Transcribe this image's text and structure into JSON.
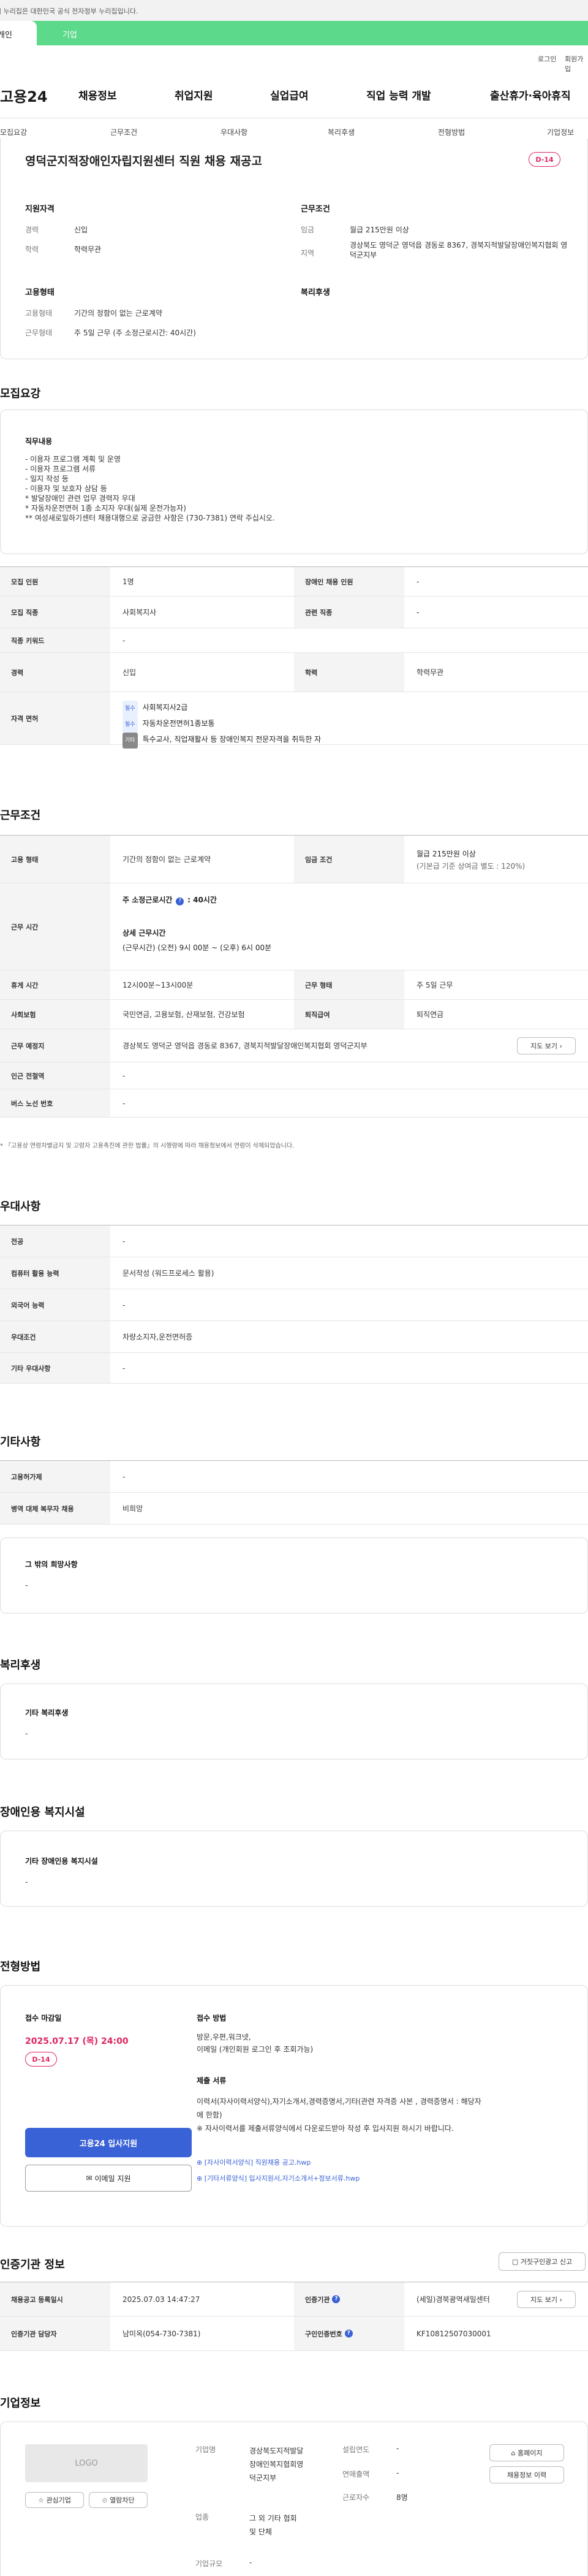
{
  "gov_notice": "이 누리집은 대한민국 공식 전자정부 누리집입니다.",
  "top_tabs": [
    "개인",
    "기업"
  ],
  "util_links": [
    "로그인",
    "회원가입"
  ],
  "logo_text": "고용24",
  "gnb": [
    "채용정보",
    "취업지원",
    "실업급여",
    "직업 능력 개발",
    "출산휴가·육아휴직"
  ],
  "subnav": [
    "모집요강",
    "근무조건",
    "우대사항",
    "복리후생",
    "전형방법",
    "기업정보"
  ],
  "summary": {
    "title": "영덕군지적장애인자립지원센터 직원 채용 재공고",
    "dday": "D-14",
    "qual_heading": "지원자격",
    "cond_heading": "근무조건",
    "emp_heading": "고용형태",
    "welfare_heading": "복리후생",
    "career_label": "경력",
    "career_value": "신입",
    "edu_label": "학력",
    "edu_value": "학력무관",
    "wage_label": "임금",
    "wage_value": "월급 215만원 이상",
    "area_label": "지역",
    "area_value": "경상북도 영덕군 영덕읍 경동로 8367, 경북지적발달장애인복지협회 영덕군지부",
    "etype_label": "고용형태",
    "etype_value": "기간의 정함이 없는 근로계약",
    "wtype_label": "근무형태",
    "wtype_value": "주 5일 근무 (주 소정근로시간: 40시간)"
  },
  "recruit": {
    "heading": "모집요강",
    "duty_title": "직무내용",
    "duty_text": "- 이용자 프로그램 계획 및 운영\n- 이용자 프로그램 서류\n- 일지 작성 등\n- 이용자 및 보호자 상담 등\n* 발달장애인 관련 업무 경력자 우대\n* 자동차운전면허 1종 소지자 우대(실제 운전가능자)\n** 여성새로일하기센터 채용대행으로 궁금한 사항은 (730-7381) 연락 주십시오.",
    "rows": {
      "headcount_label": "모집 인원",
      "headcount_value": "1명",
      "disabled_label": "장애인 채용 인원",
      "disabled_value": "-",
      "job_label": "모집 직종",
      "job_value": "사회복지사",
      "related_label": "관련 직종",
      "related_value": "-",
      "keyword_label": "직종 키워드",
      "keyword_value": "-",
      "career_label": "경력",
      "career_value": "신입",
      "edu_label": "학력",
      "edu_value": "학력무관",
      "license_label": "자격 면허",
      "license_items": [
        {
          "tag": "필수",
          "text": "사회복지사2급"
        },
        {
          "tag": "필수",
          "text": "자동차운전면허1종보통"
        },
        {
          "tag": "기타",
          "text": "특수교사, 직업재활사 등 장애인복지 전문자격을 취득한 자"
        }
      ]
    }
  },
  "conditions": {
    "heading": "근무조건",
    "etype_label": "고용 형태",
    "etype_value": "기간의 정함이 없는 근로계약",
    "wage_label": "임금 조건",
    "wage_value1": "월급 215만원 이상",
    "wage_value2": "(기본급 기준 상여금 별도 : 120%)",
    "hours_label": "근무 시간",
    "hours_weekly": "주 소정근로시간",
    "hours_weekly_value": ": 40시간",
    "hours_detail_title": "상세 근무시간",
    "hours_detail_value": "(근무시간) (오전) 9시 00분 ~ (오후) 6시 00분",
    "break_label": "휴게 시간",
    "break_value": "12시00분~13시00분",
    "form_label": "근무 형태",
    "form_value": "주 5일 근무",
    "insurance_label": "사회보험",
    "insurance_value": "국민연금, 고용보험, 산재보험, 건강보험",
    "severance_label": "퇴직급여",
    "severance_value": "퇴직연금",
    "place_label": "근무 예정지",
    "place_value": "경상북도 영덕군 영덕읍 경동로 8367, 경북지적발달장애인복지협회 영덕군지부",
    "map_button": "지도 보기",
    "subway_label": "인근 전철역",
    "subway_value": "-",
    "bus_label": "버스 노선 번호",
    "bus_value": "-",
    "note": "* 『고용상 연령차별금지 및 고령자 고용촉진에 관한 법률』의 시행령에 따라 채용정보에서 연령이 삭제되었습니다."
  },
  "pref": {
    "heading": "우대사항",
    "major_label": "전공",
    "major_value": "-",
    "pc_label": "컴퓨터 활용 능력",
    "pc_value": "문서작성 (워드프로세스 활용)",
    "lang_label": "외국어 능력",
    "lang_value": "-",
    "cond_label": "우대조건",
    "cond_value": "차량소지자,운전면허증",
    "other_label": "기타 우대사항",
    "other_value": "-"
  },
  "etc": {
    "heading": "기타사항",
    "empl_label": "고용허가제",
    "empl_value": "-",
    "military_label": "병역 대체 복무자 채용",
    "military_value": "비희망",
    "other_title": "그 밖의 희망사항",
    "other_value": "-"
  },
  "welfare": {
    "heading": "복리후생",
    "title": "기타 복리후생",
    "value": "-"
  },
  "facility": {
    "heading": "장애인용 복지시설",
    "title": "기타 장애인용 복지시설",
    "value": "-"
  },
  "process": {
    "heading": "전형방법",
    "deadline_title": "접수 마감일",
    "deadline": "2025.07.17 (목) 24:00",
    "dday": "D-14",
    "apply_button": "고용24 입사지원",
    "email_button": "이메일 지원",
    "method_title": "접수 방법",
    "method_value": "방문,우편,워크넷,\n이메일 (개인회원 로그인 후 조회가능)",
    "docs_title": "제출 서류",
    "docs_value": "이력서(자사이력서양식),자기소개서,경력증명서,기타(관련 자격증 사본 , 경력증명서 : 해당자\n에 한함)\n※ 자사이력서를 제출서류양식에서 다운로드받아 작성 후 입사지원 하시기 바랍니다.",
    "file1": "[자사이력서양식] 직원채용 공고.hwp",
    "file2": "[기타서류양식] 입사지원서,자기소개서+정보서류.hwp"
  },
  "cert": {
    "heading": "인증기관 정보",
    "report_button": "거짓구인광고 신고",
    "reg_label": "채용공고 등록일시",
    "reg_value": "2025.07.03 14:47:27",
    "agency_label": "인증기관",
    "agency_value": "(세일)경북광역새일센터",
    "map_button": "지도 보기",
    "manager_label": "인증기관 담당자",
    "manager_value": "남미옥(054-730-7381)",
    "num_label": "구인인증번호",
    "num_value": "KF10812507030001"
  },
  "company": {
    "heading": "기업정보",
    "logo_placeholder": "LOGO",
    "interest_button": "관심기업",
    "follow_button": "열람차단",
    "name_label": "기업명",
    "name_value": "경상북도지적발달\n장애인복지협회영\n덕군지부",
    "industry_label": "업종",
    "industry_value": "그 외 기타 협회\n및 단체",
    "scale_label": "기업규모",
    "scale_value": "-",
    "founded_label": "설립연도",
    "founded_value": "-",
    "sales_label": "연매출액",
    "sales_value": "-",
    "workers_label": "근로자수",
    "workers_value": "8명",
    "homepage_button": "홈페이지",
    "jobs_button": "채용정보 이력"
  }
}
